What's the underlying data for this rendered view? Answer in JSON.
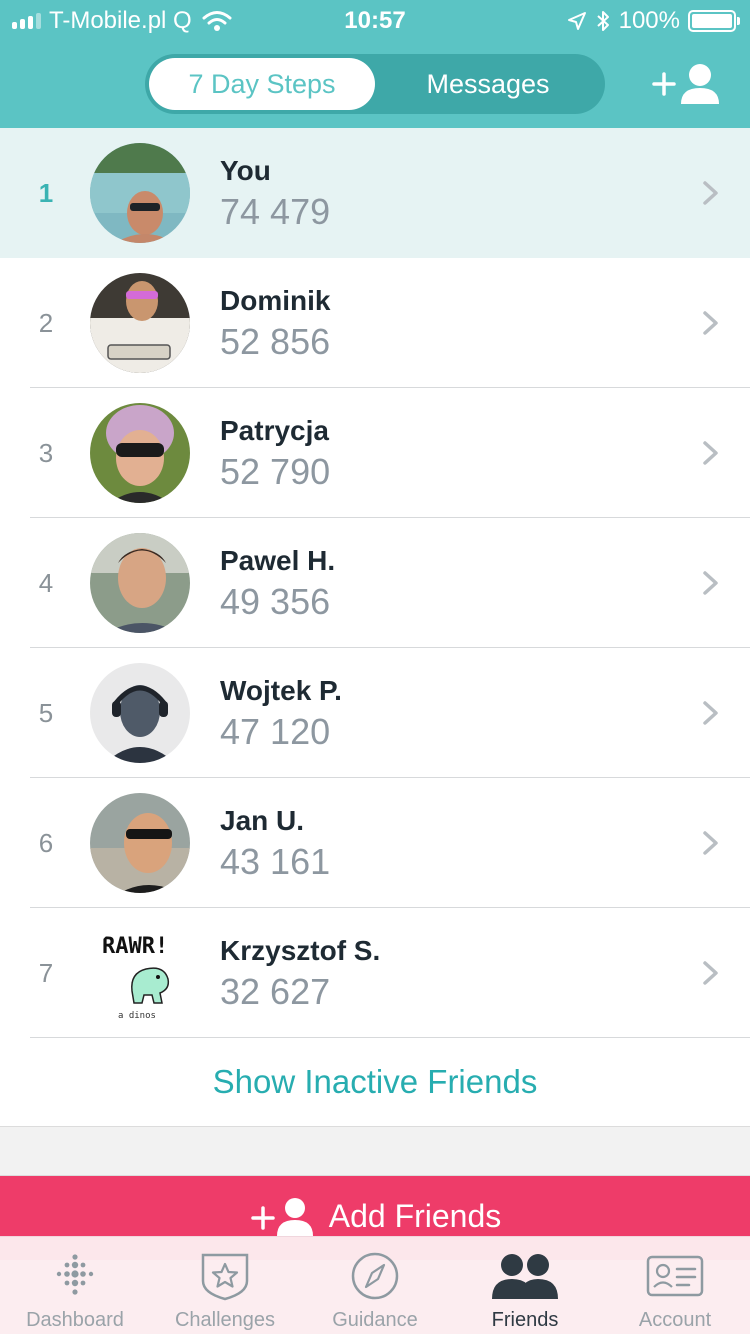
{
  "status_bar": {
    "carrier": "T-Mobile.pl Q",
    "time": "10:57",
    "battery": "100%"
  },
  "header": {
    "tabs": [
      {
        "label": "7 Day Steps",
        "active": true
      },
      {
        "label": "Messages",
        "active": false
      }
    ],
    "add_friend_icon": "add-person-icon"
  },
  "leaderboard": [
    {
      "rank": "1",
      "name": "You",
      "steps": "74 479"
    },
    {
      "rank": "2",
      "name": "Dominik",
      "steps": "52 856"
    },
    {
      "rank": "3",
      "name": "Patrycja",
      "steps": "52 790"
    },
    {
      "rank": "4",
      "name": "Pawel H.",
      "steps": "49 356"
    },
    {
      "rank": "5",
      "name": "Wojtek P.",
      "steps": "47 120"
    },
    {
      "rank": "6",
      "name": "Jan U.",
      "steps": "43 161"
    },
    {
      "rank": "7",
      "name": "Krzysztof S.",
      "steps": "32 627"
    }
  ],
  "avatar_art": {
    "rawr_text": "RAWR!",
    "dino_caption": "a dinos"
  },
  "show_inactive": "Show Inactive Friends",
  "add_friends": "Add Friends",
  "tabbar": [
    {
      "label": "Dashboard",
      "icon": "dots-grid-icon",
      "active": false
    },
    {
      "label": "Challenges",
      "icon": "star-badge-icon",
      "active": false
    },
    {
      "label": "Guidance",
      "icon": "compass-icon",
      "active": false
    },
    {
      "label": "Friends",
      "icon": "friends-icon",
      "active": true
    },
    {
      "label": "Account",
      "icon": "id-card-icon",
      "active": false
    }
  ],
  "colors": {
    "header": "#5bc4c4",
    "accent": "#27adb0",
    "add_friends": "#ee3c69",
    "highlight_row": "#e6f3f3"
  }
}
